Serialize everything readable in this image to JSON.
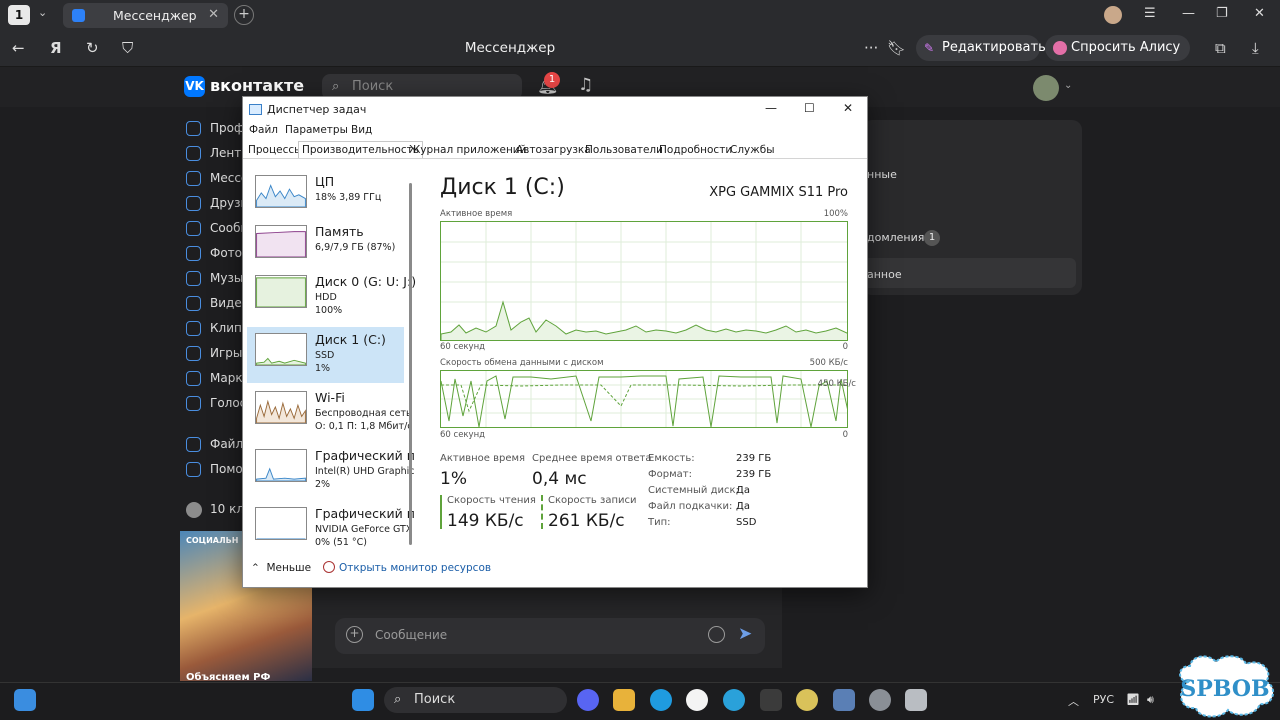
{
  "browser": {
    "tab_count": "1",
    "tab_title": "Мессенджер",
    "address_title": "Мессенджер",
    "edit_label": "Редактировать",
    "alice_label": "Спросить Алису AI"
  },
  "vk": {
    "logo_text": "вконтакте",
    "search_placeholder": "Поиск",
    "notif_count": "1",
    "sidebar": [
      {
        "label": "Профи"
      },
      {
        "label": "Лента"
      },
      {
        "label": "Мессе"
      },
      {
        "label": "Друзь"
      },
      {
        "label": "Сообщ"
      },
      {
        "label": "Фото"
      },
      {
        "label": "Музы"
      },
      {
        "label": "Видео"
      },
      {
        "label": "Клипы"
      },
      {
        "label": "Игры"
      },
      {
        "label": "Марке"
      },
      {
        "label": "Голоса"
      },
      {
        "label": "Файлы"
      },
      {
        "label": "Помо"
      }
    ],
    "right_panel": {
      "item1": "нные",
      "item2": "домления",
      "item2_badge": "1",
      "item3": "анное"
    },
    "group_row": "10 кла",
    "promo_tag": "СОЦИАЛЬН",
    "promo_caption": "Объясняем РФ",
    "message_placeholder": "Сообщение"
  },
  "task_manager": {
    "window_title": "Диспетчер задач",
    "menu": [
      "Файл",
      "Параметры",
      "Вид"
    ],
    "tabs": [
      "Процессы",
      "Производительность",
      "Журнал приложений",
      "Автозагрузка",
      "Пользователи",
      "Подробности",
      "Службы"
    ],
    "active_tab": "Производительность",
    "devices": [
      {
        "name": "ЦП",
        "sub1": "18%  3,89 ГГц",
        "sub2": "",
        "sub3": ""
      },
      {
        "name": "Память",
        "sub1": "6,9/7,9 ГБ (87%)",
        "sub2": "",
        "sub3": ""
      },
      {
        "name": "Диск 0 (G: U: J:)",
        "sub1": "HDD",
        "sub2": "100%",
        "sub3": ""
      },
      {
        "name": "Диск 1 (C:)",
        "sub1": "SSD",
        "sub2": "1%",
        "sub3": ""
      },
      {
        "name": "Wi-Fi",
        "sub1": "Беспроводная сеть",
        "sub2": "О: 0,1  П: 1,8 Мбит/с",
        "sub3": ""
      },
      {
        "name": "Графический п",
        "sub1": "Intel(R) UHD Graphic",
        "sub2": "2%",
        "sub3": ""
      },
      {
        "name": "Графический п",
        "sub1": "NVIDIA GeForce GTX",
        "sub2": "0%  (51 °C)",
        "sub3": ""
      }
    ],
    "selected_device": 3,
    "detail": {
      "title": "Диск 1 (C:)",
      "model": "XPG GAMMIX S11 Pro",
      "graph1_label": "Активное время",
      "graph1_max": "100%",
      "graph1_time": "60 секунд",
      "graph1_min": "0",
      "graph2_label": "Скорость обмена данными с диском",
      "graph2_max": "500 КБ/с",
      "graph2_mid": "450 КБ/с",
      "graph2_time": "60 секунд",
      "graph2_min": "0",
      "active_time_label": "Активное время",
      "active_time_value": "1%",
      "avg_resp_label": "Среднее время ответа",
      "avg_resp_value": "0,4 мс",
      "read_label": "Скорость чтения",
      "read_value": "149 КБ/с",
      "write_label": "Скорость записи",
      "write_value": "261 КБ/с",
      "props": [
        {
          "k": "Емкость:",
          "v": "239 ГБ"
        },
        {
          "k": "Формат:",
          "v": "239 ГБ"
        },
        {
          "k": "Системный диск:",
          "v": "Да"
        },
        {
          "k": "Файл подкачки:",
          "v": "Да"
        },
        {
          "k": "Тип:",
          "v": "SSD"
        }
      ],
      "graph_color": "#5fa33b"
    },
    "footer_less": "Меньше",
    "footer_monitor": "Открыть монитор ресурсов"
  },
  "taskbar": {
    "search_label": "Поиск",
    "lang": "РУС"
  },
  "watermark": "SPBOB"
}
